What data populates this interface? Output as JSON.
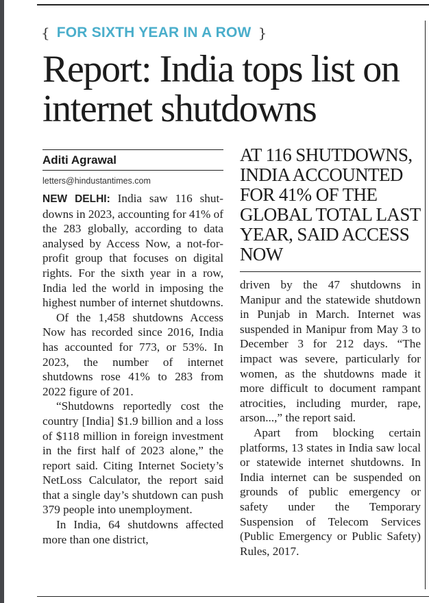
{
  "kicker": {
    "brace_open": "{",
    "label": "FOR SIXTH YEAR IN A ROW",
    "brace_close": "}",
    "color": "#4aaecb"
  },
  "headline": "Report: India tops list on internet shutdowns",
  "byline": {
    "author": "Aditi Agrawal",
    "email": "letters@hindustantimes.com"
  },
  "pullquote": "AT 116 SHUTDOWNS, INDIA ACCOUNTED FOR 41% OF THE GLOBAL TOTAL LAST YEAR, SAID ACCESS NOW",
  "article": {
    "dateline": "NEW DELHI:",
    "left_paragraphs": [
      "India saw 116 shut­downs in 2023, accounting for 41% of the 283 globally, accord­ing to data analysed by Access Now, a not-for-profit group that focuses on digital rights. For the sixth year in a row, India led the world in imposing the highest number of internet shutdowns.",
      "Of the 1,458 shutdowns Access Now has recorded since 2016, India has accounted for 773, or 53%. In 2023, the num­ber of internet shutdowns rose 41% to 283 from 2022 figure of 201.",
      "“Shutdowns reportedly cost the country [India] $1.9 billion and a loss of $118 million in for­eign investment in the first half of 2023 alone,” the report said. Citing Internet Society’s NetLoss Calculator, the report said that a single day’s shutdown can push 379 people into unemployment.",
      "In India, 64 shutdowns affected more than one district,"
    ],
    "right_paragraphs": [
      "driven by the 47 shutdowns in Manipur and the statewide shutdown in Punjab in March. Internet was suspended in Man­ipur from May 3 to December 3 for 212 days. “The impact was severe, particularly for women, as the shutdowns made it more difficult to document rampant atrocities, including murder, rape, arson...,” the report said.",
      "Apart from blocking certain platforms, 13 states in India saw local or statewide internet shut­downs. In India internet can be suspended on grounds of public emergency or safety under the Temporary Suspension of Tele­com Services (Public Emer­gency or Public Safety) Rules, 2017."
    ]
  }
}
